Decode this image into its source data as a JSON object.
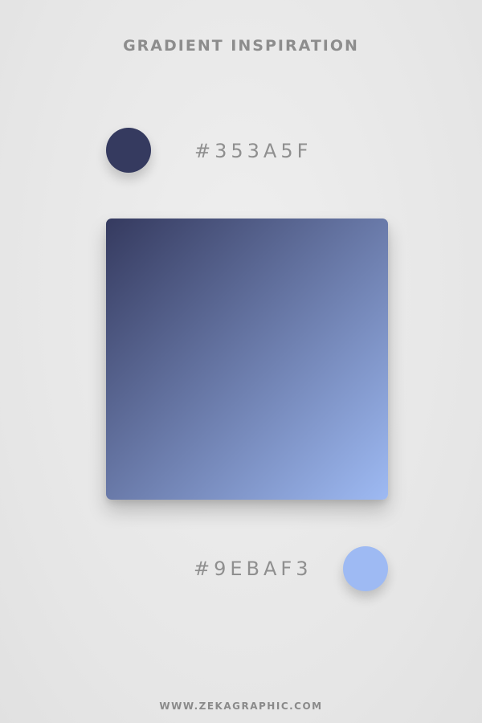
{
  "header": {
    "title": "GRADIENT INSPIRATION"
  },
  "colors": {
    "start": {
      "hex_label": "#353A5F",
      "value": "#353a5f"
    },
    "end": {
      "hex_label": "#9EBAF3",
      "value": "#9ebaf3"
    }
  },
  "gradient": {
    "direction": "top-left to bottom-right"
  },
  "footer": {
    "website": "WWW.ZEKAGRAPHIC.COM"
  }
}
